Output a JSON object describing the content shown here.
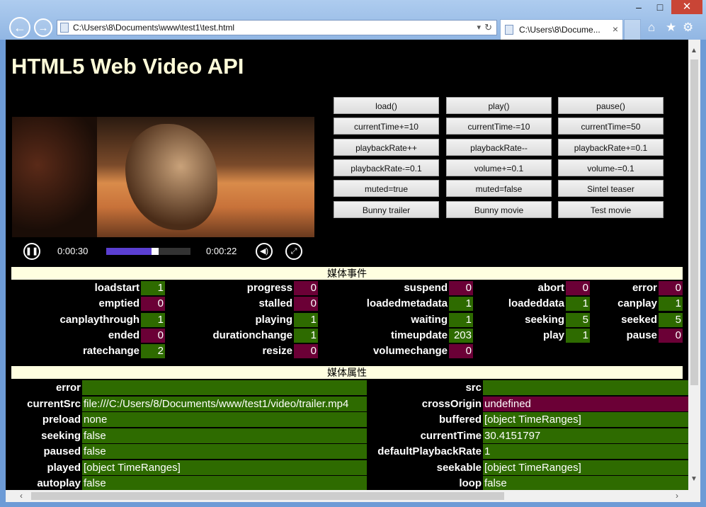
{
  "browser": {
    "address": "C:\\Users\\8\\Documents\\www\\test1\\test.html",
    "tab_title": "C:\\Users\\8\\Docume...",
    "window_controls": {
      "minimize": "–",
      "maximize": "□",
      "close": "✕"
    }
  },
  "colors": {
    "good": "#2e6b00",
    "bad": "#6b0036",
    "section_bg": "#ffffe0",
    "title": "#fffbd8"
  },
  "page": {
    "title": "HTML5 Web Video API"
  },
  "video": {
    "time_elapsed": "0:00:30",
    "time_remaining": "0:00:22",
    "progress_fraction": 0.58
  },
  "buttons": [
    [
      "load()",
      "play()",
      "pause()"
    ],
    [
      "currentTime+=10",
      "currentTime-=10",
      "currentTime=50"
    ],
    [
      "playbackRate++",
      "playbackRate--",
      "playbackRate+=0.1"
    ],
    [
      "playbackRate-=0.1",
      "volume+=0.1",
      "volume-=0.1"
    ],
    [
      "muted=true",
      "muted=false",
      "Sintel teaser"
    ],
    [
      "Bunny trailer",
      "Bunny movie",
      "Test movie"
    ]
  ],
  "events_title": "媒体事件",
  "events": [
    [
      {
        "name": "loadstart",
        "value": "1",
        "good": true
      },
      {
        "name": "progress",
        "value": "0",
        "good": false
      },
      {
        "name": "suspend",
        "value": "0",
        "good": false
      },
      {
        "name": "abort",
        "value": "0",
        "good": false
      },
      {
        "name": "error",
        "value": "0",
        "good": false
      }
    ],
    [
      {
        "name": "emptied",
        "value": "0",
        "good": false
      },
      {
        "name": "stalled",
        "value": "0",
        "good": false
      },
      {
        "name": "loadedmetadata",
        "value": "1",
        "good": true
      },
      {
        "name": "loadeddata",
        "value": "1",
        "good": true
      },
      {
        "name": "canplay",
        "value": "1",
        "good": true
      }
    ],
    [
      {
        "name": "canplaythrough",
        "value": "1",
        "good": true
      },
      {
        "name": "playing",
        "value": "1",
        "good": true
      },
      {
        "name": "waiting",
        "value": "1",
        "good": true
      },
      {
        "name": "seeking",
        "value": "5",
        "good": true
      },
      {
        "name": "seeked",
        "value": "5",
        "good": true
      }
    ],
    [
      {
        "name": "ended",
        "value": "0",
        "good": false
      },
      {
        "name": "durationchange",
        "value": "1",
        "good": true
      },
      {
        "name": "timeupdate",
        "value": "203",
        "good": true
      },
      {
        "name": "play",
        "value": "1",
        "good": true
      },
      {
        "name": "pause",
        "value": "0",
        "good": false
      }
    ],
    [
      {
        "name": "ratechange",
        "value": "2",
        "good": true
      },
      {
        "name": "resize",
        "value": "0",
        "good": false
      },
      {
        "name": "volumechange",
        "value": "0",
        "good": false
      }
    ]
  ],
  "props_title": "媒体属性",
  "props": [
    [
      {
        "name": "error",
        "value": "",
        "good": true
      },
      {
        "name": "src",
        "value": "",
        "good": true
      }
    ],
    [
      {
        "name": "currentSrc",
        "value": "file:///C:/Users/8/Documents/www/test1/video/trailer.mp4",
        "good": true
      },
      {
        "name": "crossOrigin",
        "value": "undefined",
        "good": false
      }
    ],
    [
      {
        "name": "preload",
        "value": "none",
        "good": true
      },
      {
        "name": "buffered",
        "value": "[object TimeRanges]",
        "good": true
      }
    ],
    [
      {
        "name": "seeking",
        "value": "false",
        "good": true
      },
      {
        "name": "currentTime",
        "value": "30.4151797",
        "good": true
      }
    ],
    [
      {
        "name": "paused",
        "value": "false",
        "good": true
      },
      {
        "name": "defaultPlaybackRate",
        "value": "1",
        "good": true
      }
    ],
    [
      {
        "name": "played",
        "value": "[object TimeRanges]",
        "good": true
      },
      {
        "name": "seekable",
        "value": "[object TimeRanges]",
        "good": true
      }
    ],
    [
      {
        "name": "autoplay",
        "value": "false",
        "good": true
      },
      {
        "name": "loop",
        "value": "false",
        "good": true
      }
    ]
  ]
}
